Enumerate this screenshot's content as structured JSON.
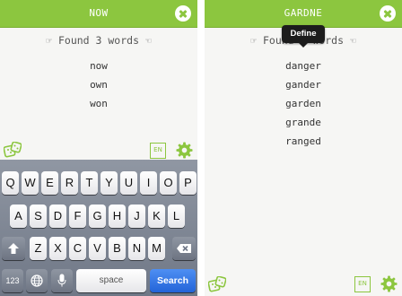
{
  "colors": {
    "accent": "#8cc63f",
    "search_blue": "#2a6cdc"
  },
  "left_screen": {
    "title": "NOW",
    "found_text": "Found 3 words",
    "hand_left": "☞",
    "hand_right": "☜",
    "words": [
      "now",
      "own",
      "won"
    ],
    "language_button": "EN",
    "icons": [
      "close-icon",
      "dice-icon",
      "gear-icon"
    ]
  },
  "right_screen": {
    "title": "GARDNE",
    "found_text": "Found 5 words",
    "hand_left": "☞",
    "hand_right": "☜",
    "tooltip": "Define",
    "words": [
      "danger",
      "gander",
      "garden",
      "grande",
      "ranged"
    ],
    "language_button": "EN",
    "icons": [
      "close-icon",
      "dice-icon",
      "gear-icon"
    ]
  },
  "keyboard": {
    "row1": [
      "Q",
      "W",
      "E",
      "R",
      "T",
      "Y",
      "U",
      "I",
      "O",
      "P"
    ],
    "row2": [
      "A",
      "S",
      "D",
      "F",
      "G",
      "H",
      "J",
      "K",
      "L"
    ],
    "row3": [
      "Z",
      "X",
      "C",
      "V",
      "B",
      "N",
      "M"
    ],
    "numbers_key": "123",
    "space_key": "space",
    "search_key": "Search",
    "icons": [
      "shift-icon",
      "backspace-icon",
      "globe-icon",
      "microphone-icon"
    ]
  }
}
